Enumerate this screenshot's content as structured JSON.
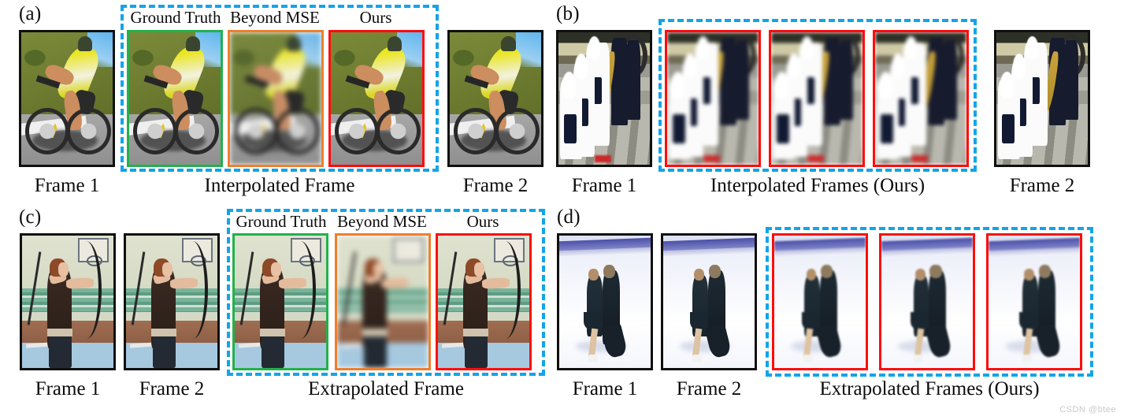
{
  "figure": {
    "watermark": "CSDN @btee"
  },
  "panels": [
    {
      "id": "a",
      "tag": "(a)",
      "left_frame": {
        "label": "Frame 1",
        "border": "#101010"
      },
      "group": {
        "caption": "Interpolated Frame",
        "items": [
          {
            "label": "Ground Truth",
            "border": "#22B14C"
          },
          {
            "label": "Beyond MSE",
            "border": "#EE7F2D"
          },
          {
            "label": "Ours",
            "border": "#FF0C0C"
          }
        ]
      },
      "right_frame": {
        "label": "Frame 2",
        "border": "#101010"
      }
    },
    {
      "id": "b",
      "tag": "(b)",
      "left_frame": {
        "label": "Frame 1",
        "border": "#101010"
      },
      "group": {
        "caption": "Interpolated Frames (Ours)",
        "items": [
          {
            "label": "",
            "border": "#FF0C0C"
          },
          {
            "label": "",
            "border": "#FF0C0C"
          },
          {
            "label": "",
            "border": "#FF0C0C"
          }
        ]
      },
      "right_frame": {
        "label": "Frame 2",
        "border": "#101010"
      }
    },
    {
      "id": "c",
      "tag": "(c)",
      "left_frames": [
        {
          "label": "Frame 1",
          "border": "#101010"
        },
        {
          "label": "Frame 2",
          "border": "#101010"
        }
      ],
      "group": {
        "caption": "Extrapolated Frame",
        "items": [
          {
            "label": "Ground Truth",
            "border": "#22B14C"
          },
          {
            "label": "Beyond MSE",
            "border": "#EE7F2D"
          },
          {
            "label": "Ours",
            "border": "#FF0C0C"
          }
        ]
      }
    },
    {
      "id": "d",
      "tag": "(d)",
      "left_frames": [
        {
          "label": "Frame 1",
          "border": "#101010"
        },
        {
          "label": "Frame 2",
          "border": "#101010"
        }
      ],
      "group": {
        "caption": "Extrapolated Frames (Ours)",
        "items": [
          {
            "label": "",
            "border": "#FF0C0C"
          },
          {
            "label": "",
            "border": "#FF0C0C"
          },
          {
            "label": "",
            "border": "#FF0C0C"
          }
        ]
      }
    }
  ],
  "colors": {
    "dashed_group": "#13A4E8",
    "ground_truth": "#22B14C",
    "beyond_mse": "#EE7F2D",
    "ours": "#FF0C0C",
    "frame": "#101010"
  }
}
